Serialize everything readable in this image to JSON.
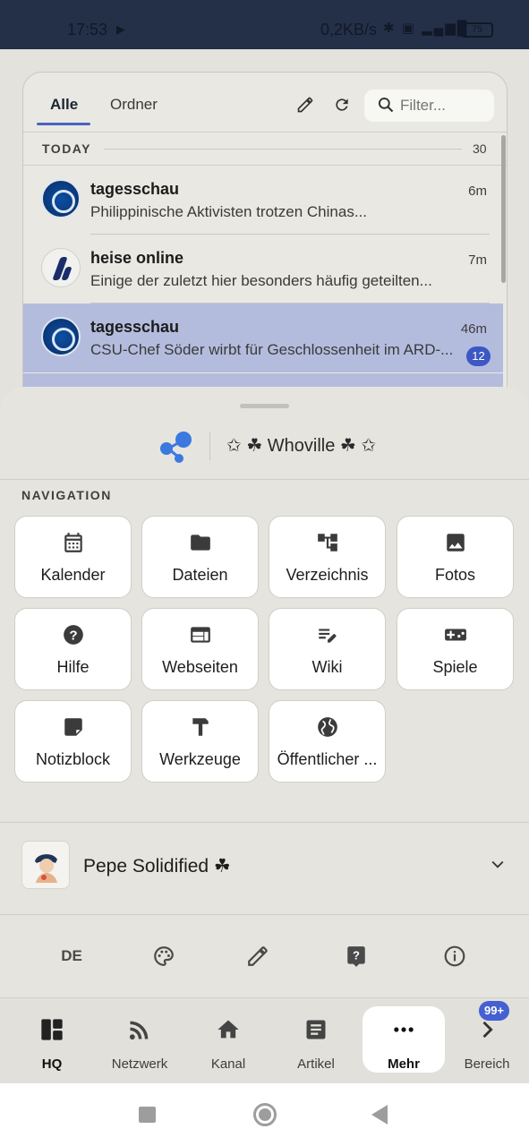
{
  "status_bar": {
    "time": "17:53",
    "network_speed": "0,2KB/s",
    "battery": "75"
  },
  "feed": {
    "tabs": [
      {
        "label": "Alle",
        "active": true
      },
      {
        "label": "Ordner",
        "active": false
      }
    ],
    "filter_placeholder": "Filter...",
    "section_label": "TODAY",
    "section_count": "30",
    "items": [
      {
        "source": "tagesschau",
        "age": "6m",
        "preview": "Philippinische Aktivisten trotzen Chinas...",
        "icon": "tagesschau-logo",
        "highlighted": false
      },
      {
        "source": "heise online",
        "age": "7m",
        "preview": "Einige der zuletzt hier besonders häufig geteilten...",
        "icon": "heise-logo",
        "highlighted": false
      },
      {
        "source": "tagesschau",
        "age": "46m",
        "preview": "CSU-Chef Söder wirbt für Geschlossenheit im ARD-...",
        "icon": "tagesschau-logo",
        "highlighted": true,
        "badge": "12"
      }
    ]
  },
  "sheet": {
    "brand_name": "✩ ☘ Whoville ☘ ✩",
    "section_title": "NAVIGATION",
    "tiles": [
      {
        "label": "Kalender",
        "icon": "calendar-icon"
      },
      {
        "label": "Dateien",
        "icon": "folder-icon"
      },
      {
        "label": "Verzeichnis",
        "icon": "directory-tree-icon"
      },
      {
        "label": "Fotos",
        "icon": "image-icon"
      },
      {
        "label": "Hilfe",
        "icon": "help-icon"
      },
      {
        "label": "Webseiten",
        "icon": "web-icon"
      },
      {
        "label": "Wiki",
        "icon": "edit-note-icon"
      },
      {
        "label": "Spiele",
        "icon": "gamepad-icon"
      },
      {
        "label": "Notizblock",
        "icon": "sticky-note-icon"
      },
      {
        "label": "Werkzeuge",
        "icon": "hammer-icon"
      },
      {
        "label": "Öffentlicher ...",
        "icon": "globe-icon"
      }
    ],
    "profile_name": "Pepe Solidified ☘",
    "quick_actions": {
      "language": "DE",
      "icons": [
        "palette-icon",
        "pencil-icon",
        "help-bubble-icon",
        "info-icon"
      ]
    }
  },
  "bottom_nav": {
    "items": [
      {
        "label": "HQ",
        "icon": "dashboard-icon"
      },
      {
        "label": "Netzwerk",
        "icon": "rss-icon"
      },
      {
        "label": "Kanal",
        "icon": "home-icon"
      },
      {
        "label": "Artikel",
        "icon": "article-icon"
      },
      {
        "label": "Mehr",
        "icon": "more-icon",
        "active": true
      },
      {
        "label": "Bereich",
        "icon": "chevron-right-icon"
      }
    ],
    "badge": "99+"
  }
}
